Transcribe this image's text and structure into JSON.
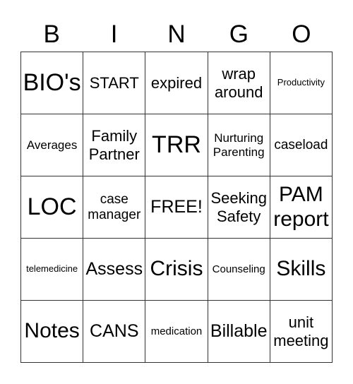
{
  "header": [
    "B",
    "I",
    "N",
    "G",
    "O"
  ],
  "cells": [
    [
      "BIO's",
      "START",
      "expired",
      "wrap around",
      "Productivity"
    ],
    [
      "Averages",
      "Family Partner",
      "TRR",
      "Nurturing Parenting",
      "caseload"
    ],
    [
      "LOC",
      "case manager",
      "FREE!",
      "Seeking Safety",
      "PAM report"
    ],
    [
      "telemedicine",
      "Assess",
      "Crisis",
      "Counseling",
      "Skills"
    ],
    [
      "Notes",
      "CANS",
      "medication",
      "Billable",
      "unit meeting"
    ]
  ]
}
